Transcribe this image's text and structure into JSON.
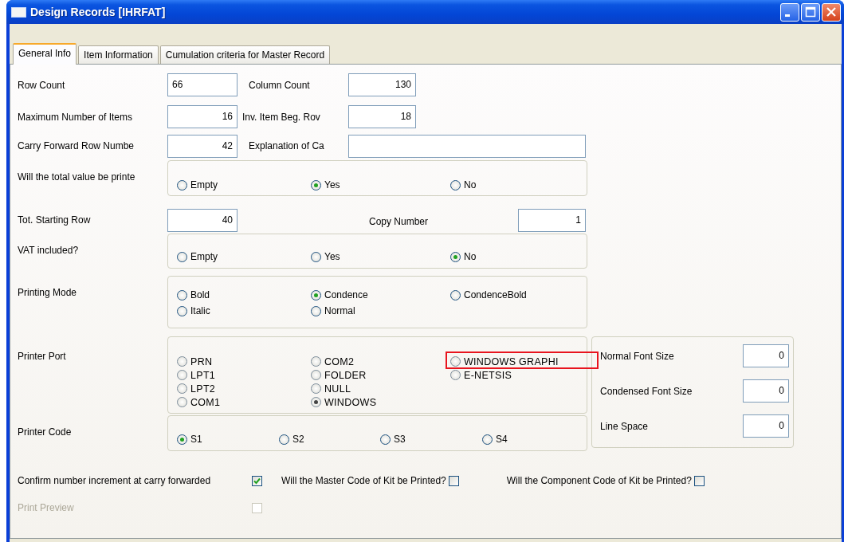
{
  "window": {
    "title": "Design Records [IHRFAT]"
  },
  "tabs": [
    {
      "label": "General Info",
      "selected": true
    },
    {
      "label": "Item Information",
      "selected": false
    },
    {
      "label": "Cumulation criteria for Master Record",
      "selected": false
    }
  ],
  "form": {
    "row_count": {
      "label": "Row Count",
      "value": "66"
    },
    "column_count": {
      "label": "Column Count",
      "value": "130"
    },
    "max_items": {
      "label": "Maximum Number of Items",
      "value": "16"
    },
    "inv_item_beg_row": {
      "label": "Inv. Item Beg. Rov",
      "value": "18"
    },
    "carry_forward_row": {
      "label": "Carry Forward Row Numbe",
      "value": "42"
    },
    "explanation": {
      "label": "Explanation of Ca"
    },
    "total_printed": {
      "label": "Will the total value be printe",
      "columns": [
        [
          {
            "label": "Empty",
            "selected": false
          }
        ],
        [
          {
            "label": "Yes",
            "selected": true
          }
        ],
        [
          {
            "label": "No",
            "selected": false
          }
        ]
      ]
    },
    "tot_starting_row": {
      "label": "Tot. Starting Row",
      "value": "40"
    },
    "copy_number": {
      "label": "Copy Number",
      "value": "1"
    },
    "vat_included": {
      "label": "VAT included?",
      "columns": [
        [
          {
            "label": "Empty",
            "selected": false
          }
        ],
        [
          {
            "label": "Yes",
            "selected": false
          }
        ],
        [
          {
            "label": "No",
            "selected": true
          }
        ]
      ]
    },
    "printing_mode": {
      "label": "Printing Mode",
      "columns": [
        [
          {
            "label": "Bold",
            "selected": false
          },
          {
            "label": "Italic",
            "selected": false
          }
        ],
        [
          {
            "label": "Condence",
            "selected": true
          },
          {
            "label": "Normal",
            "selected": false
          }
        ],
        [
          {
            "label": "CondenceBold",
            "selected": false
          }
        ]
      ]
    },
    "printer_port": {
      "label": "Printer Port",
      "columns": [
        [
          {
            "label": "PRN",
            "selected": false,
            "highlighted": false
          },
          {
            "label": "LPT1",
            "selected": false,
            "highlighted": false
          },
          {
            "label": "LPT2",
            "selected": false,
            "highlighted": false
          },
          {
            "label": "COM1",
            "selected": false,
            "highlighted": false
          }
        ],
        [
          {
            "label": "COM2",
            "selected": false,
            "highlighted": false
          },
          {
            "label": "FOLDER",
            "selected": false,
            "highlighted": false
          },
          {
            "label": "NULL",
            "selected": false,
            "highlighted": false
          },
          {
            "label": "WINDOWS",
            "selected": true,
            "highlighted": false
          }
        ],
        [
          {
            "label": "WINDOWS GRAPHI",
            "selected": false,
            "highlighted": true
          },
          {
            "label": "E-NETSIS",
            "selected": false,
            "highlighted": false
          }
        ]
      ]
    },
    "printer_code": {
      "label": "Printer Code",
      "columns": [
        [
          {
            "label": "S1",
            "selected": true
          }
        ],
        [
          {
            "label": "S2",
            "selected": false
          }
        ],
        [
          {
            "label": "S3",
            "selected": false
          }
        ],
        [
          {
            "label": "S4",
            "selected": false
          }
        ]
      ]
    },
    "font_settings": [
      {
        "label": "Normal Font Size",
        "value": "0"
      },
      {
        "label": "Condensed Font Size",
        "value": "0"
      },
      {
        "label": "Line Space",
        "value": "0"
      }
    ],
    "checkboxes": [
      {
        "label": "Confirm number increment at carry forwarded",
        "checked": true,
        "disabled": false
      },
      {
        "label": "Will the Master Code of Kit be Printed?",
        "checked": false,
        "disabled": false
      },
      {
        "label": "Will the Component Code of Kit be Printed?",
        "checked": false,
        "disabled": false
      },
      {
        "label": "Print Preview",
        "checked": false,
        "disabled": true
      }
    ]
  }
}
